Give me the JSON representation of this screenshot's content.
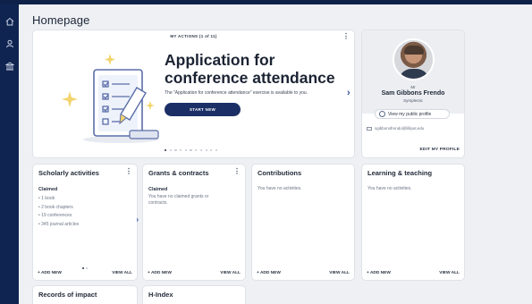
{
  "page": {
    "title": "Homepage"
  },
  "sidebar": {
    "items": [
      {
        "icon": "home-icon"
      },
      {
        "icon": "user-icon"
      },
      {
        "icon": "building-icon"
      }
    ]
  },
  "actions": {
    "header": "MY ACTIONS (1 of 11)",
    "title_line1": "Application for",
    "title_line2": "conference attendance",
    "description": "The \"Application for conference attendance\" exercise is available to you.",
    "button": "START NEW",
    "pager_total": 11,
    "pager_current": 1
  },
  "profile": {
    "salutation": "Mr",
    "name": "Sam Gibbons Frendo",
    "org": "Symplectic",
    "public_link": "View my public profile",
    "email": "sgibbonsfrendo@lilliput.edu",
    "edit": "EDIT MY PROFILE"
  },
  "widgets": {
    "scholarly": {
      "title": "Scholarly activities",
      "subtitle": "Claimed",
      "items": [
        "1 book",
        "2 book chapters",
        "19 conferences",
        "345 journal articles"
      ],
      "add": "+ ADD NEW",
      "view": "VIEW ALL"
    },
    "grants": {
      "title": "Grants & contracts",
      "subtitle": "Claimed",
      "text": "You have no claimed grants or contracts.",
      "add": "+ ADD NEW",
      "view": "VIEW ALL"
    },
    "contributions": {
      "title": "Contributions",
      "text": "You have no activities.",
      "add": "+ ADD NEW",
      "view": "VIEW ALL"
    },
    "learning": {
      "title": "Learning & teaching",
      "text": "You have no activities.",
      "add": "+ ADD NEW",
      "view": "VIEW ALL"
    },
    "records": {
      "title": "Records of impact"
    },
    "hindex": {
      "title": "H-Index"
    }
  },
  "colors": {
    "nav": "#0f2450",
    "accent": "#1b2f66",
    "link": "#2f4c9a"
  }
}
